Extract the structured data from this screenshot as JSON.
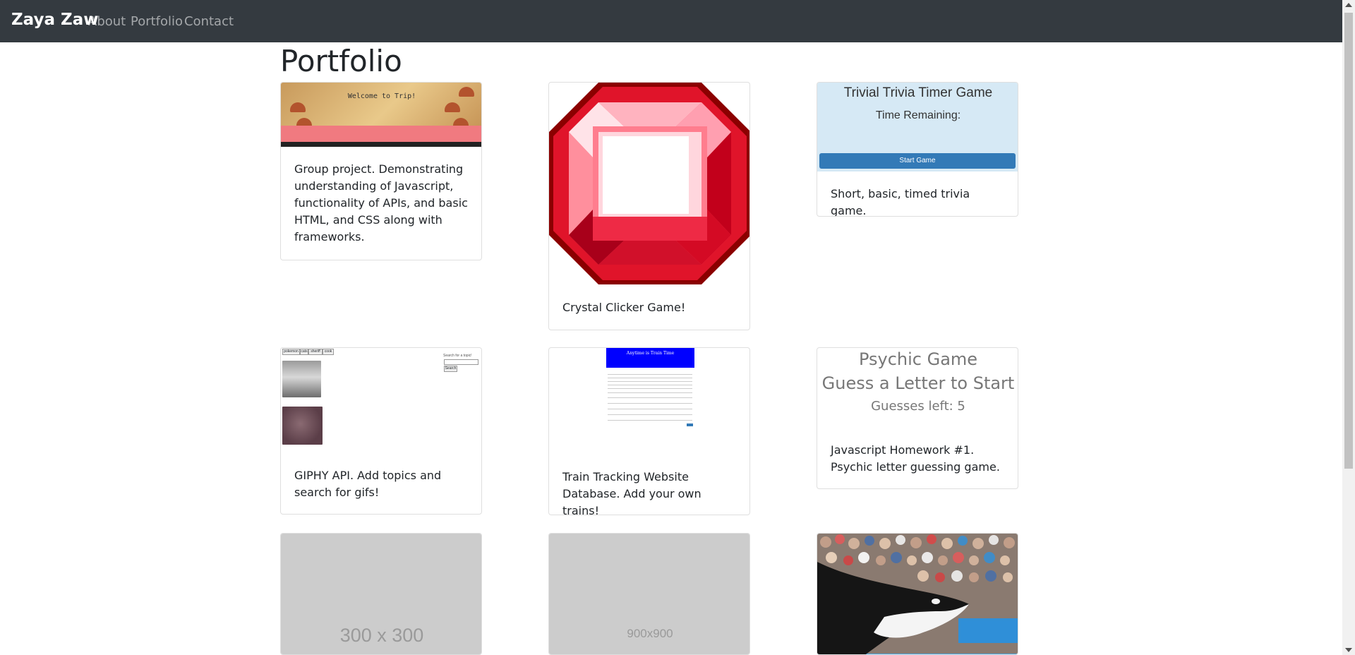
{
  "nav": {
    "brand": "Zaya Zaw",
    "links": [
      "About",
      "Portfolio",
      "Contact"
    ]
  },
  "page": {
    "title": "Portfolio"
  },
  "cards": [
    {
      "thumb_title": "Welcome to Trip!",
      "text": "Group project. Demonstrating understanding of Javascript, functionality of APIs, and basic HTML, and CSS along with frameworks."
    },
    {
      "text": "Crystal Clicker Game!"
    },
    {
      "thumb_title": "Trivial Trivia Timer Game",
      "thumb_subtitle": "Time Remaining:",
      "thumb_button": "Start Game",
      "text": "Short, basic, timed trivia game."
    },
    {
      "thumb_buttons": [
        "pokemon",
        "cats",
        "sheriff",
        "cook"
      ],
      "thumb_label": "Search for a topic!",
      "thumb_search": "Search",
      "text": "GIPHY API. Add topics and search for gifs!"
    },
    {
      "thumb_title": "Anytime is Train Time",
      "text": "Train Tracking Website Database. Add your own trains!"
    },
    {
      "thumb_lines": [
        "Psychic Game",
        "Guess a Letter to Start",
        "Guesses left: 5"
      ],
      "text": "Javascript Homework #1. Psychic letter guessing game."
    },
    {
      "placeholder": "300 x 300"
    },
    {
      "placeholder": "900x900"
    },
    {}
  ],
  "colors": {
    "navbar": "#343a40",
    "trivia_bg": "#d6e9f5",
    "trivia_button": "#337ab7",
    "train_header": "#0000ff",
    "placeholder": "#cccccc",
    "trip_banner": "#f07a80"
  }
}
